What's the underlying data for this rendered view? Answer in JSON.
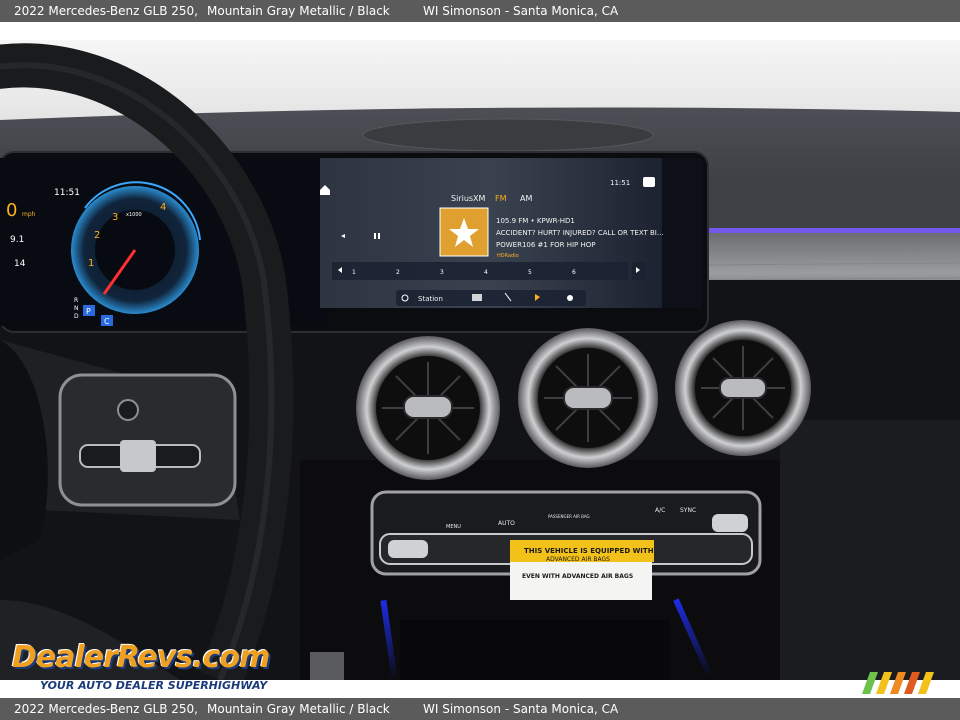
{
  "caption": {
    "model": "2022 Mercedes-Benz GLB 250,",
    "color": "Mountain Gray Metallic / Black",
    "dealer": "WI Simonson - Santa Monica, CA"
  },
  "infotainment": {
    "source": "SiriusXM",
    "band_fm": "FM",
    "band_am": "AM",
    "time": "11:51",
    "station": "105.9 FM • KPWR-HD1",
    "line1": "ACCIDENT? HURT? INJURED? CALL OR TEXT BI...",
    "line2": "POWER106 #1 FOR HIP HOP",
    "hd_label": "HDRadio",
    "station_button": "Station",
    "presets": [
      "1",
      "2",
      "3",
      "4",
      "5",
      "6"
    ]
  },
  "cluster": {
    "time": "11:51",
    "speed": "0",
    "speed_unit": "mph",
    "odometer": "9.1",
    "trip": "14",
    "gauge_marks": [
      "2",
      "3",
      "1",
      "4"
    ],
    "gear_letters": [
      "R",
      "N",
      "D"
    ],
    "gear_selected": "P",
    "drive_mode": "C",
    "rpm_label": "x1000"
  },
  "climate": {
    "labels": [
      "MENU",
      "AUTO",
      "PASSENGER AIR BAG",
      "A/C",
      "SYNC"
    ]
  },
  "airbag_label": {
    "line1": "THIS VEHICLE IS EQUIPPED WITH",
    "line2": "ADVANCED AIR BAGS",
    "line3": "EVEN WITH ADVANCED AIR BAGS"
  },
  "watermark": {
    "logo": "DealerRevs.com",
    "tagline": "YOUR AUTO DEALER SUPERHIGHWAY"
  },
  "colors": {
    "caption_bar": "#5b5b5b",
    "ambient_light": "#7a5cff",
    "screen_glow": "#1e2a3a",
    "label_yellow": "#f3c21a",
    "cluster_red": "#ff3030"
  }
}
